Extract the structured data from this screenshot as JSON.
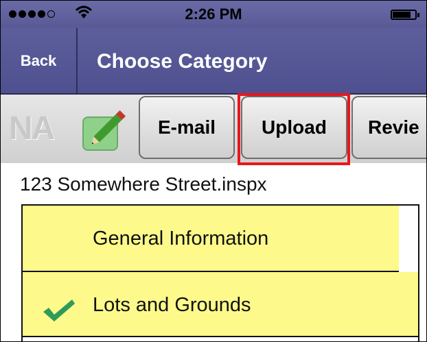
{
  "status_bar": {
    "time": "2:26 PM",
    "signal_icon": "signal-dots-icon",
    "wifi_icon": "wifi-icon",
    "battery_icon": "battery-icon"
  },
  "nav": {
    "back_label": "Back",
    "title": "Choose Category"
  },
  "toolbar": {
    "logo_text": "NA",
    "edit_icon": "pencil-icon",
    "email_label": "E-mail",
    "upload_label": "Upload",
    "review_label": "Revie"
  },
  "file": {
    "name": "123 Somewhere Street.inspx"
  },
  "categories": [
    {
      "label": "General Information",
      "checked": false
    },
    {
      "label": "Lots and Grounds",
      "checked": true
    }
  ],
  "colors": {
    "nav_bar": "#5d5e9c",
    "list_item": "#fdfa8b",
    "highlight": "#e8161c",
    "check": "#2e9b5a"
  }
}
